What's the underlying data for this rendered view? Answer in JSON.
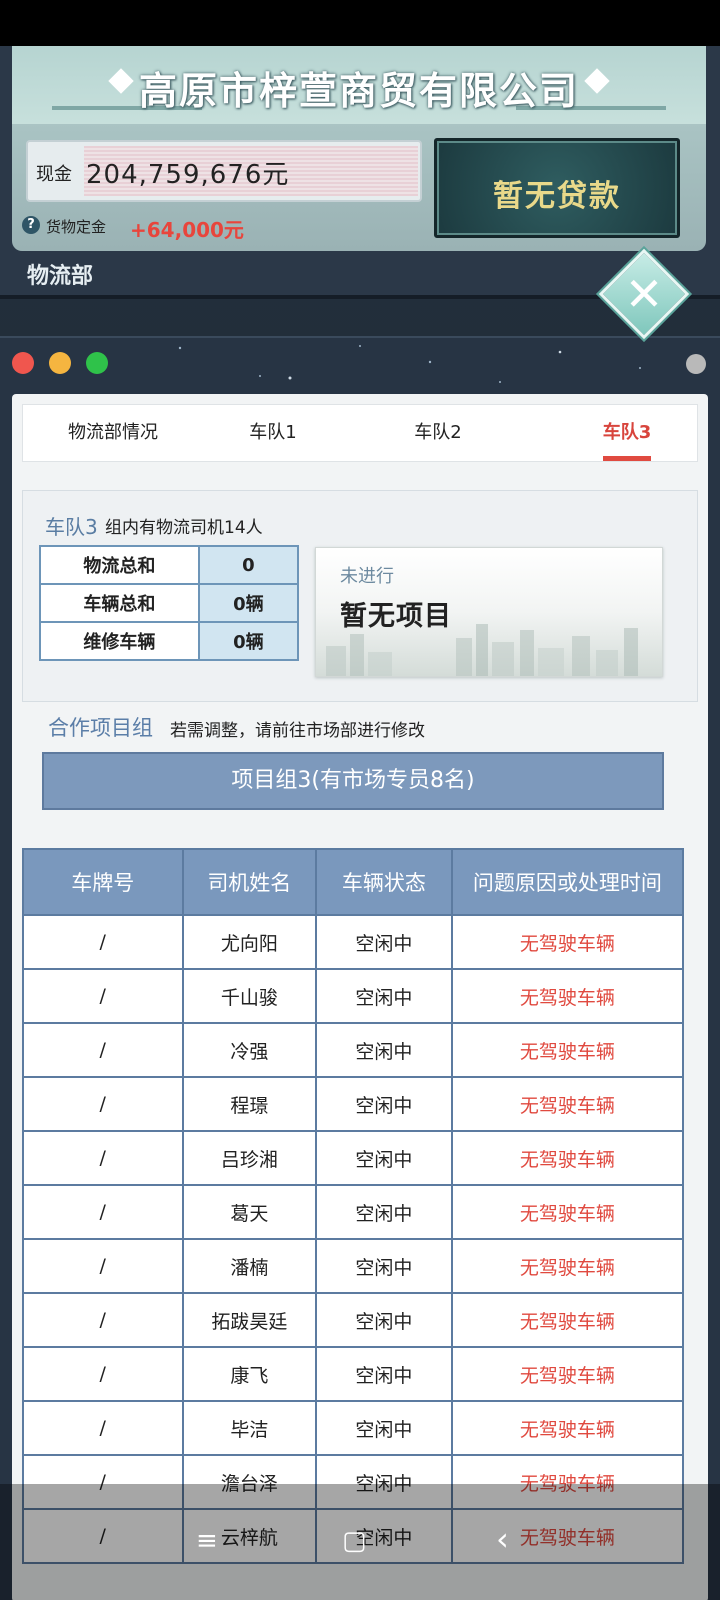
{
  "header": {
    "company_name": "高原市梓萱商贸有限公司",
    "cash_label": "现金",
    "cash_value": "204,759,676元",
    "deposit_label": "货物定金",
    "deposit_value": "+64,000元",
    "loan_button": "暂无贷款",
    "department": "物流部",
    "help_icon": "question-icon",
    "close_icon": "close-icon"
  },
  "tabs": [
    {
      "label": "物流部情况",
      "active": false
    },
    {
      "label": "车队1",
      "active": false
    },
    {
      "label": "车队2",
      "active": false
    },
    {
      "label": "车队3",
      "active": true
    }
  ],
  "fleet": {
    "name": "车队3",
    "description": "组内有物流司机14人",
    "stats": [
      {
        "key": "物流总和",
        "value": "0"
      },
      {
        "key": "车辆总和",
        "value": "0辆"
      },
      {
        "key": "维修车辆",
        "value": "0辆"
      }
    ],
    "project_status": "未进行",
    "project_title": "暂无项目"
  },
  "cooperation": {
    "label": "合作项目组",
    "hint": "若需调整，请前往市场部进行修改",
    "group_button": "项目组3(有市场专员8名)"
  },
  "table": {
    "headers": [
      "车牌号",
      "司机姓名",
      "车辆状态",
      "问题原因或处理时间"
    ],
    "rows": [
      {
        "plate": "/",
        "name": "尤向阳",
        "status": "空闲中",
        "issue": "无驾驶车辆"
      },
      {
        "plate": "/",
        "name": "千山骏",
        "status": "空闲中",
        "issue": "无驾驶车辆"
      },
      {
        "plate": "/",
        "name": "冷强",
        "status": "空闲中",
        "issue": "无驾驶车辆"
      },
      {
        "plate": "/",
        "name": "程璟",
        "status": "空闲中",
        "issue": "无驾驶车辆"
      },
      {
        "plate": "/",
        "name": "吕珍湘",
        "status": "空闲中",
        "issue": "无驾驶车辆"
      },
      {
        "plate": "/",
        "name": "葛天",
        "status": "空闲中",
        "issue": "无驾驶车辆"
      },
      {
        "plate": "/",
        "name": "潘楠",
        "status": "空闲中",
        "issue": "无驾驶车辆"
      },
      {
        "plate": "/",
        "name": "拓跋昊廷",
        "status": "空闲中",
        "issue": "无驾驶车辆"
      },
      {
        "plate": "/",
        "name": "康飞",
        "status": "空闲中",
        "issue": "无驾驶车辆"
      },
      {
        "plate": "/",
        "name": "毕洁",
        "status": "空闲中",
        "issue": "无驾驶车辆"
      },
      {
        "plate": "/",
        "name": "澹台泽",
        "status": "空闲中",
        "issue": "无驾驶车辆"
      },
      {
        "plate": "/",
        "name": "云梓航",
        "status": "空闲中",
        "issue": "无驾驶车辆"
      }
    ]
  },
  "nav": {
    "menu_icon": "≡",
    "home_icon": "▢",
    "back_icon": "‹"
  },
  "colors": {
    "accent_red": "#e04a40",
    "header_blue": "#7a98bd",
    "title_blue": "#5b7ea8"
  }
}
